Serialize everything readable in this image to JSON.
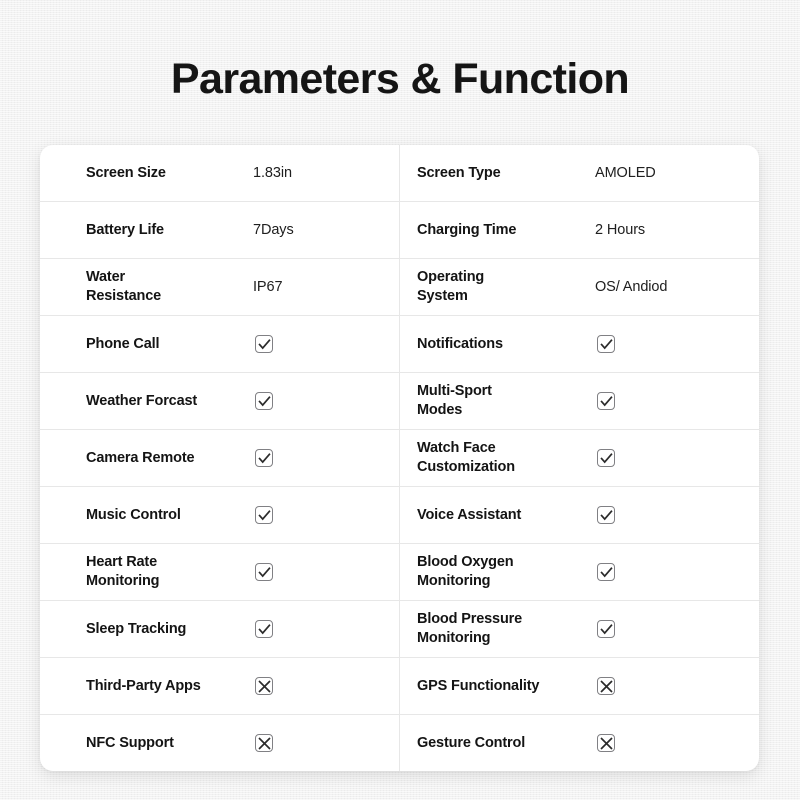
{
  "page": {
    "title": "Parameters & Function",
    "background_color": "#f1f1f1",
    "card_color": "#ffffff",
    "text_color": "#141414",
    "border_color": "#e7e7e7",
    "mark_border_color": "#808084"
  },
  "table": {
    "rows": [
      {
        "left": {
          "label": "Screen Size",
          "type": "text",
          "value": "1.83in"
        },
        "right": {
          "label": "Screen Type",
          "type": "text",
          "value": "AMOLED"
        }
      },
      {
        "left": {
          "label": "Battery Life",
          "type": "text",
          "value": "7Days"
        },
        "right": {
          "label": "Charging Time",
          "type": "text",
          "value": "2 Hours"
        }
      },
      {
        "left": {
          "label": "Water\nResistance",
          "type": "text",
          "value": "IP67"
        },
        "right": {
          "label": "Operating\nSystem",
          "type": "text",
          "value": "OS/ Andiod"
        }
      },
      {
        "left": {
          "label": "Phone Call",
          "type": "check",
          "value": "checked"
        },
        "right": {
          "label": "Notifications",
          "type": "check",
          "value": "checked"
        }
      },
      {
        "left": {
          "label": "Weather Forcast",
          "type": "check",
          "value": "checked"
        },
        "right": {
          "label": "Multi-Sport\nModes",
          "type": "check",
          "value": "checked"
        }
      },
      {
        "left": {
          "label": "Camera Remote",
          "type": "check",
          "value": "checked"
        },
        "right": {
          "label": "Watch Face\nCustomization",
          "type": "check",
          "value": "checked"
        }
      },
      {
        "left": {
          "label": "Music Control",
          "type": "check",
          "value": "checked"
        },
        "right": {
          "label": "Voice Assistant",
          "type": "check",
          "value": "checked"
        }
      },
      {
        "left": {
          "label": "Heart Rate\nMonitoring",
          "type": "check",
          "value": "checked"
        },
        "right": {
          "label": "Blood Oxygen\nMonitoring",
          "type": "check",
          "value": "checked"
        }
      },
      {
        "left": {
          "label": "Sleep Tracking",
          "type": "check",
          "value": "checked"
        },
        "right": {
          "label": "Blood Pressure\nMonitoring",
          "type": "check",
          "value": "checked"
        }
      },
      {
        "left": {
          "label": "Third-Party Apps",
          "type": "cross",
          "value": "unchecked"
        },
        "right": {
          "label": "GPS Functionality",
          "type": "cross",
          "value": "unchecked"
        }
      },
      {
        "left": {
          "label": "NFC Support",
          "type": "cross",
          "value": "unchecked"
        },
        "right": {
          "label": "Gesture Control",
          "type": "cross",
          "value": "unchecked"
        }
      }
    ]
  },
  "icons": {
    "check": "checkbox-checked-icon",
    "cross": "checkbox-crossed-icon"
  }
}
